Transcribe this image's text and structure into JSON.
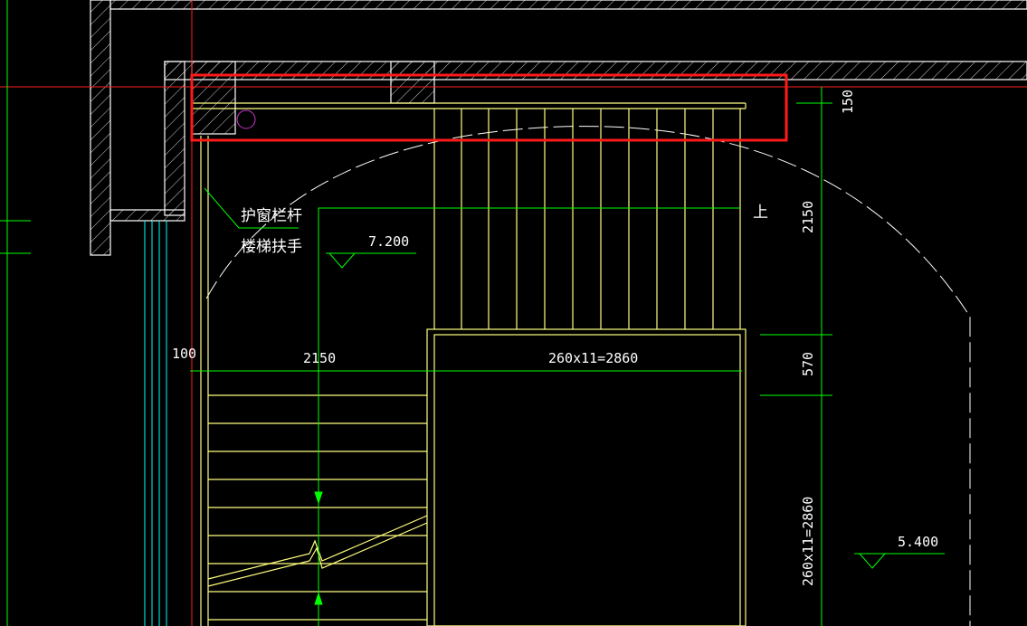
{
  "colors": {
    "background": "#000000",
    "wall": "#ffffff",
    "stair": "#ffff80",
    "dimension": "#00ff00",
    "axis": "#ff2020",
    "highlight": "#ff1a1a",
    "window": "#00ffff",
    "text": "#ffffff"
  },
  "annotations": {
    "window_railing": "护窗栏杆",
    "stair_handrail": "楼梯扶手",
    "up_arrow": "上"
  },
  "elevations": {
    "upper": "7.200",
    "lower": "5.400"
  },
  "dimensions": {
    "top_clearance": "150",
    "landing_depth_vertical": "2150",
    "gap_vertical": "570",
    "flight_run_vertical": "260x11=2860",
    "wall_offset": "100",
    "landing_width": "2150",
    "flight_run_horizontal": "260x11=2860"
  }
}
